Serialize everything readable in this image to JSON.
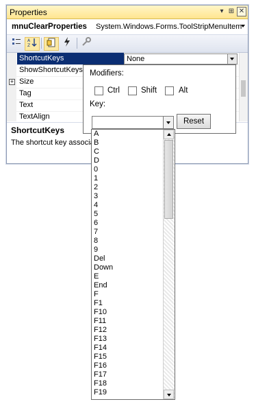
{
  "window": {
    "title": "Properties",
    "object_name": "mnuClearProperties",
    "object_type": "System.Windows.Forms.ToolStripMenuItem"
  },
  "toolbar": {
    "icons": [
      "categorized-icon",
      "alphabetical-icon",
      "properties-icon",
      "events-icon",
      "property-pages-icon"
    ]
  },
  "grid": {
    "rows": [
      {
        "name": "ShortcutKeys",
        "value": "None",
        "selected": true
      },
      {
        "name": "ShowShortcutKeys",
        "value": ""
      },
      {
        "name": "Size",
        "value": "",
        "expandable": true
      },
      {
        "name": "Tag",
        "value": ""
      },
      {
        "name": "Text",
        "value": ""
      },
      {
        "name": "TextAlign",
        "value": ""
      }
    ]
  },
  "description": {
    "title": "ShortcutKeys",
    "text": "The shortcut key associa"
  },
  "editor": {
    "modifiers_label": "Modifiers:",
    "ctrl_label": "Ctrl",
    "shift_label": "Shift",
    "alt_label": "Alt",
    "key_label": "Key:",
    "key_value": "",
    "reset_label": "Reset"
  },
  "key_list": [
    "A",
    "B",
    "C",
    "D",
    "0",
    "1",
    "2",
    "3",
    "4",
    "5",
    "6",
    "7",
    "8",
    "9",
    "Del",
    "Down",
    "E",
    "End",
    "F",
    "F1",
    "F10",
    "F11",
    "F12",
    "F13",
    "F14",
    "F15",
    "F16",
    "F17",
    "F18",
    "F19"
  ],
  "colors": {
    "selection": "#0b2e73",
    "title_bar": "#ffe58f"
  }
}
